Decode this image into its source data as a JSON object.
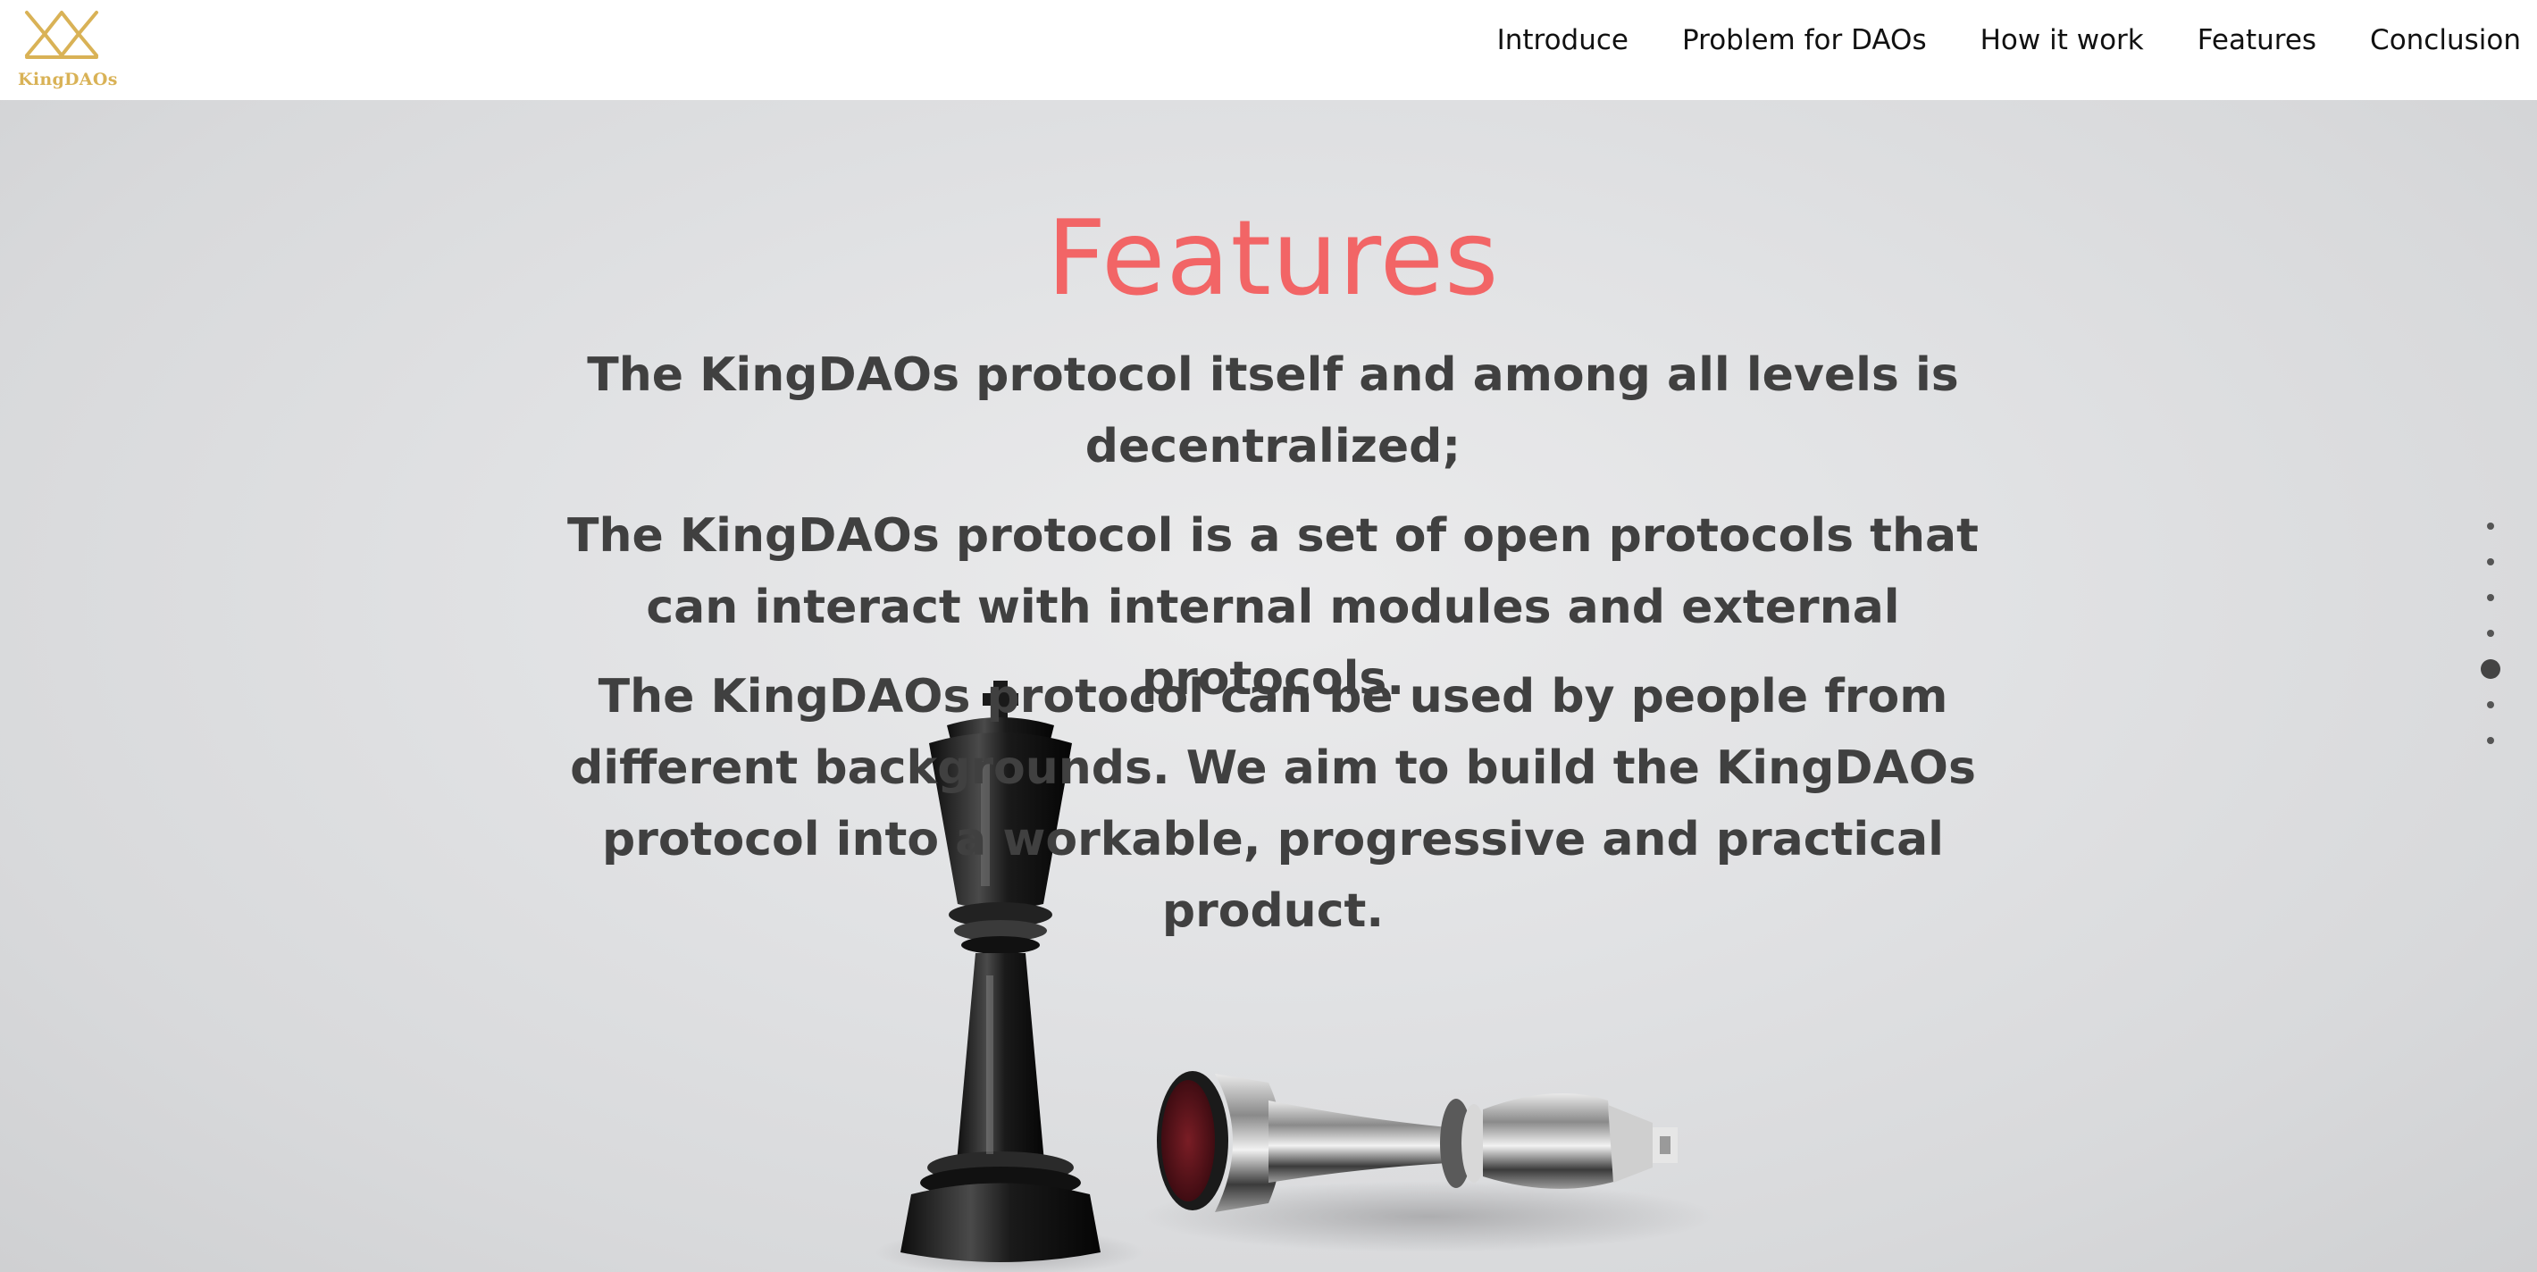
{
  "brand": {
    "logo_text": "KingDAOs",
    "logo_icon": "crown-icon",
    "logo_color": "#d9b256"
  },
  "nav": {
    "items": [
      {
        "label": "Introduce"
      },
      {
        "label": "Problem for DAOs"
      },
      {
        "label": "How it work"
      },
      {
        "label": "Features"
      },
      {
        "label": "Conclusion"
      }
    ]
  },
  "hero": {
    "title": "Features",
    "title_color": "#f26566",
    "text_color": "#404040",
    "paragraphs": [
      "The KingDAOs protocol itself and among all levels is decentralized;",
      "The KingDAOs protocol is a set of open protocols that can interact with internal modules and external protocols.",
      "The KingDAOs protocol can be used by people from different backgrounds. We aim to build the KingDAOs protocol into a workable, progressive and practical product."
    ],
    "background_image": "chess-king-pieces-photo"
  },
  "section_nav": {
    "total": 7,
    "active_index": 4
  }
}
